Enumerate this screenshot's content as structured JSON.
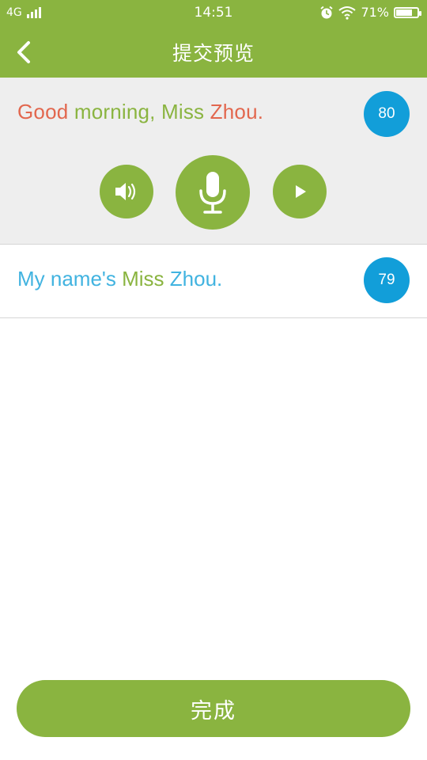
{
  "status_bar": {
    "network": "4G",
    "time": "14:51",
    "battery_percent": "71%",
    "icons": [
      "signal-icon",
      "alarm-icon",
      "wifi-icon",
      "battery-icon"
    ]
  },
  "nav": {
    "title": "提交预览",
    "back_icon": "chevron-left-icon"
  },
  "items": [
    {
      "words": [
        {
          "text": "Good",
          "color": "#e2674e"
        },
        {
          "text": " morning, Miss ",
          "color": "#8ab440"
        },
        {
          "text": "Zhou.",
          "color": "#e2674e"
        }
      ],
      "score": "80",
      "controls": [
        "speaker-icon",
        "microphone-icon",
        "play-icon"
      ]
    },
    {
      "words": [
        {
          "text": "My name's ",
          "color": "#41b3e0"
        },
        {
          "text": "Miss",
          "color": "#8ab440"
        },
        {
          "text": " Zhou.",
          "color": "#41b3e0"
        }
      ],
      "score": "79"
    }
  ],
  "footer": {
    "done_label": "完成"
  },
  "colors": {
    "primary_green": "#8ab440",
    "score_blue": "#129ed9",
    "panel_gray": "#eeeeee"
  }
}
